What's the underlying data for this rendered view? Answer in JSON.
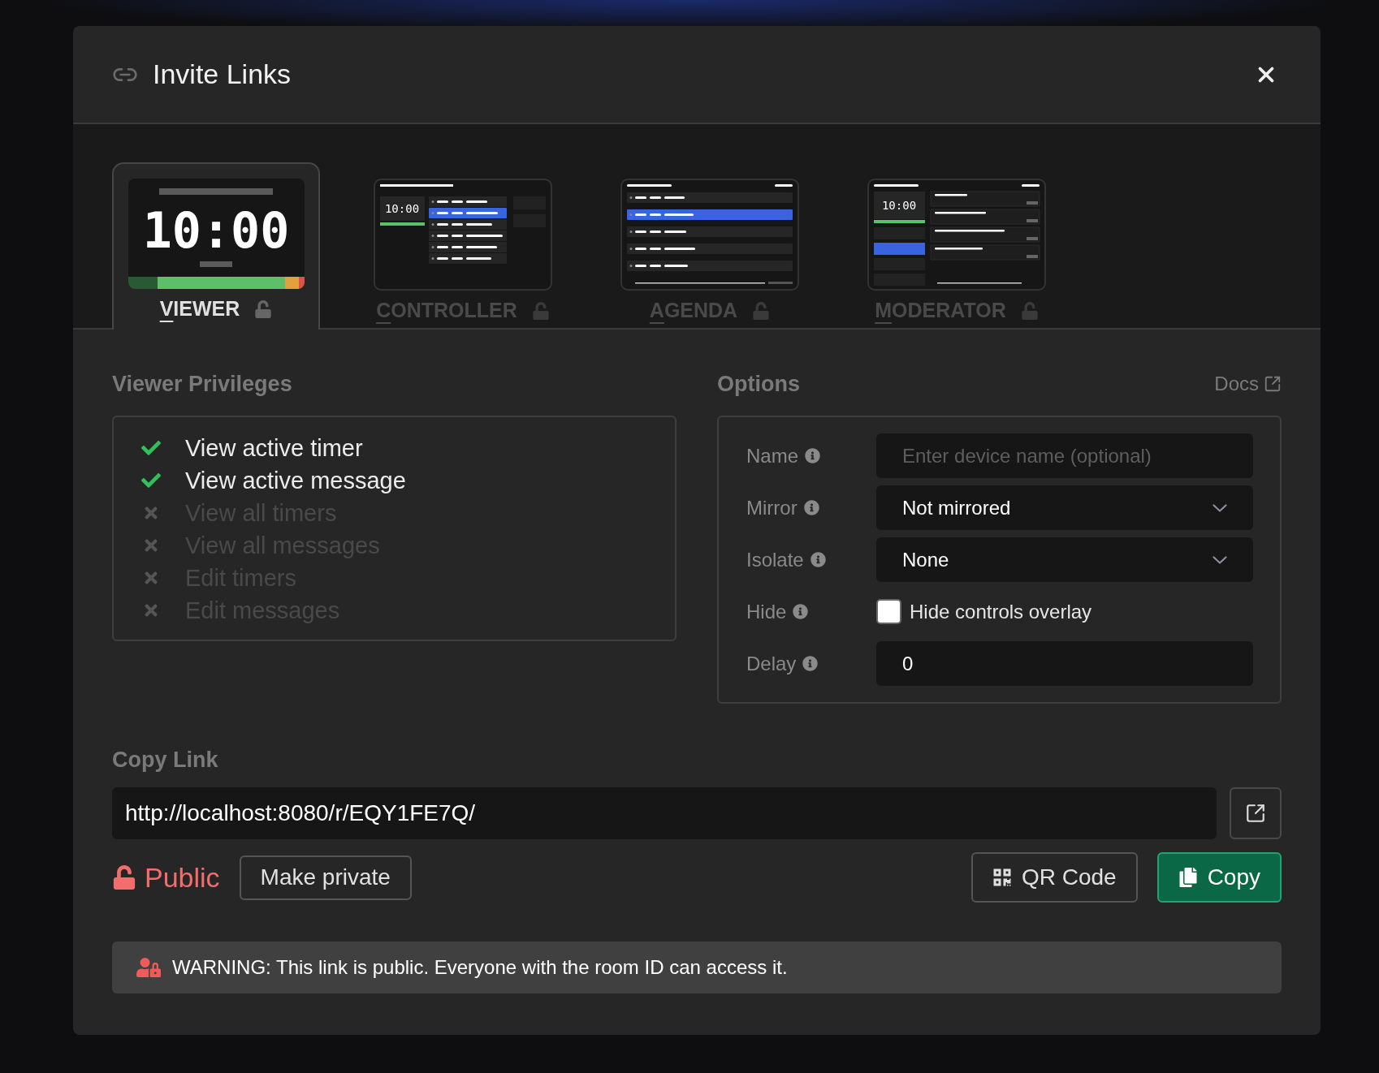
{
  "dialog": {
    "title": "Invite Links"
  },
  "tabs": [
    {
      "label": "VIEWER",
      "kind": "viewer",
      "selected": true,
      "preview_time": "10:00"
    },
    {
      "label": "CONTROLLER",
      "kind": "controller",
      "selected": false,
      "preview_time": "10:00"
    },
    {
      "label": "AGENDA",
      "kind": "agenda",
      "selected": false
    },
    {
      "label": "MODERATOR",
      "kind": "moderator",
      "selected": false,
      "preview_time": "10:00"
    }
  ],
  "privileges": {
    "title": "Viewer Privileges",
    "items": [
      {
        "label": "View active timer",
        "allowed": true
      },
      {
        "label": "View active message",
        "allowed": true
      },
      {
        "label": "View all timers",
        "allowed": false
      },
      {
        "label": "View all messages",
        "allowed": false
      },
      {
        "label": "Edit timers",
        "allowed": false
      },
      {
        "label": "Edit messages",
        "allowed": false
      }
    ]
  },
  "options": {
    "title": "Options",
    "docs_link": "Docs",
    "fields": [
      {
        "label": "Name",
        "kind": "text",
        "placeholder": "Enter device name (optional)"
      },
      {
        "label": "Mirror",
        "kind": "select",
        "value": "Not mirrored"
      },
      {
        "label": "Isolate",
        "kind": "select",
        "value": "None"
      },
      {
        "label": "Hide",
        "kind": "checkbox",
        "checked": false,
        "text": "Hide controls overlay"
      },
      {
        "label": "Delay",
        "kind": "text",
        "value": "0"
      }
    ]
  },
  "copy_link": {
    "title": "Copy Link",
    "url": "http://localhost:8080/r/EQY1FE7Q/",
    "visibility": "Public",
    "make_private": "Make private",
    "qr_code": "QR Code",
    "copy": "Copy"
  },
  "warning": "WARNING: This link is public. Everyone with the room ID can access it."
}
